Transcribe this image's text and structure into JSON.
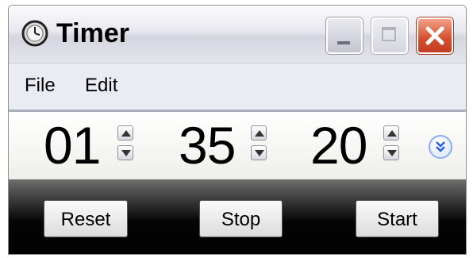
{
  "window": {
    "title": "Timer"
  },
  "title_bar": {
    "icon": "clock-icon",
    "buttons": {
      "minimize": "minimize-icon",
      "maximize": "maximize-icon",
      "close": "close-icon"
    }
  },
  "menu": {
    "items": [
      {
        "label": "File"
      },
      {
        "label": "Edit"
      }
    ]
  },
  "timer": {
    "hours": "01",
    "minutes": "35",
    "seconds": "20",
    "expand_icon": "double-chevron-down-icon"
  },
  "buttons": {
    "reset": "Reset",
    "stop": "Stop",
    "start": "Start"
  },
  "colors": {
    "close_button": "#d34d2d",
    "button_row_bg": "#000000",
    "expand_accent": "#2a5de0"
  }
}
